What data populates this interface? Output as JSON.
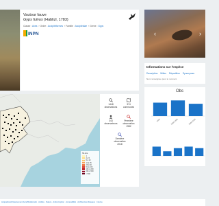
{
  "species": {
    "common_name": "Vautour fauve",
    "scientific_name": "Gyps fulvus",
    "author": "(Hablizl, 1783)",
    "taxonomy": [
      {
        "label": "Classe :",
        "value": "Aves"
      },
      {
        "label": "Ordre :",
        "value": "Accipitriformes"
      },
      {
        "label": "Famille :",
        "value": "Accipitridae"
      },
      {
        "label": "Genre :",
        "value": "Gyps"
      }
    ],
    "logo_text": "INPN"
  },
  "info": {
    "title": "Informations sur l'espèce",
    "tabs": [
      "Description",
      "Milieu",
      "Répartition",
      "Synonymes"
    ],
    "empty_text": "Non renseignée pour le moment"
  },
  "stats": {
    "observations": {
      "value": "1448",
      "label": "observations"
    },
    "communes": {
      "value": "374",
      "label": "communes"
    },
    "observateurs": {
      "value": "343",
      "label": "observateurs"
    },
    "premiere": {
      "label": "Première observation",
      "value": "1982"
    },
    "derniere": {
      "label": "Dernière observation",
      "value": "2018"
    }
  },
  "map_legend": {
    "title": "Nb obs.",
    "items": [
      {
        "label": "1",
        "color": "#fff5c0"
      },
      {
        "label": "2 à 5",
        "color": "#fde39a"
      },
      {
        "label": "6 à 10",
        "color": "#fcc774"
      },
      {
        "label": "11 à 25",
        "color": "#f9a25a"
      },
      {
        "label": "26 à 50",
        "color": "#ef7a4a"
      },
      {
        "label": "51 à 100",
        "color": "#dc4e3f"
      },
      {
        "label": "101 à 200",
        "color": "#bf2b36"
      },
      {
        "label": "201 à 500",
        "color": "#96162e"
      },
      {
        "label": "> 500",
        "color": "#6b0a24"
      }
    ]
  },
  "charts": {
    "title": "Obs",
    "color": "#1a73c8",
    "chart_data": [
      {
        "type": "bar",
        "categories": [
          "1800",
          "1950-1990",
          "1990-2000"
        ],
        "values": [
          6,
          7,
          5.5
        ],
        "ylim": [
          0,
          8
        ]
      },
      {
        "type": "bar",
        "categories": [
          "",
          "",
          "",
          "",
          ""
        ],
        "values": [
          3,
          1.5,
          2.5,
          3,
          2.5
        ],
        "ylim": [
          0,
          4
        ]
      }
    ]
  },
  "footer": {
    "text": "Acquisitions/Financement de la Biodiversité · Arrêtés · Natura · Anticorruption · Accessibilité · Architecture Réseaux · Interne"
  }
}
